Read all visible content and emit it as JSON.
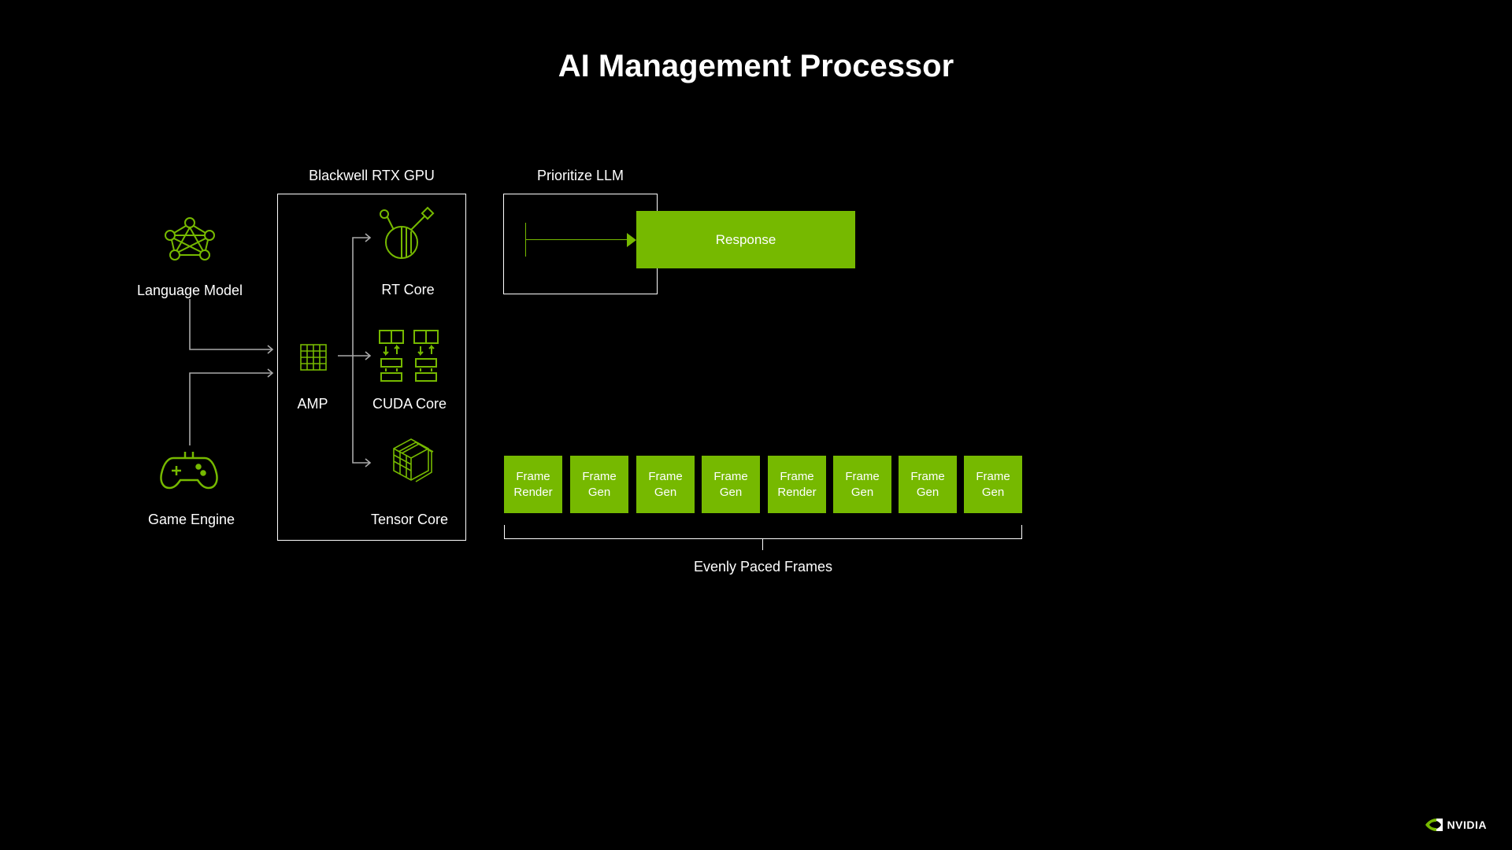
{
  "title": "AI Management Processor",
  "left_inputs": {
    "language_model": "Language Model",
    "game_engine": "Game Engine"
  },
  "gpu": {
    "heading": "Blackwell RTX GPU",
    "amp": "AMP",
    "rt_core": "RT Core",
    "cuda_core": "CUDA Core",
    "tensor_core": "Tensor Core"
  },
  "prioritize_llm": {
    "heading": "Prioritize LLM",
    "response": "Response"
  },
  "frames": {
    "caption": "Evenly Paced Frames",
    "items": [
      "Frame\nRender",
      "Frame\nGen",
      "Frame\nGen",
      "Frame\nGen",
      "Frame\nRender",
      "Frame\nGen",
      "Frame\nGen",
      "Frame\nGen"
    ]
  },
  "brand": "NVIDIA",
  "colors": {
    "accent": "#76b900"
  }
}
